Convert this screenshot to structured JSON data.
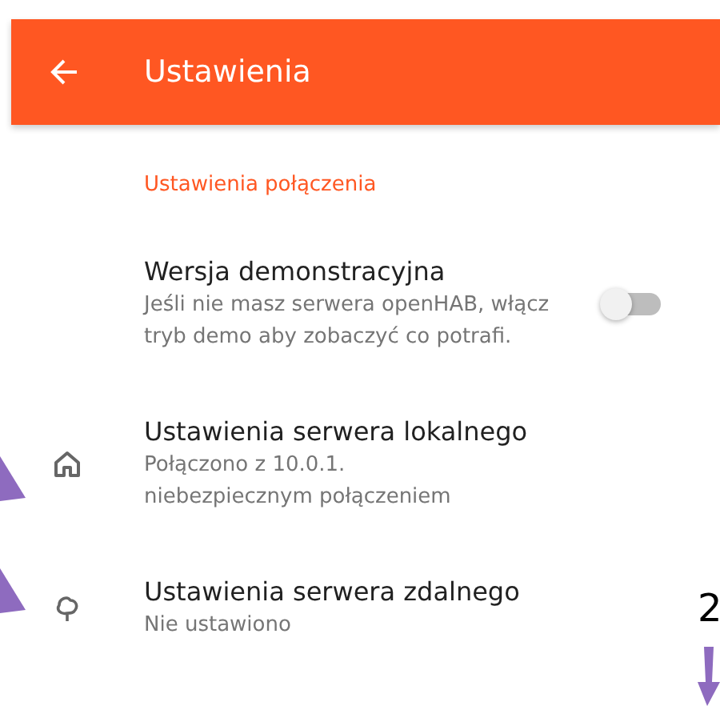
{
  "app_bar": {
    "title": "Ustawienia"
  },
  "category": "Ustawienia połączenia",
  "items": [
    {
      "kind": "switch",
      "title": "Wersja demonstracyjna",
      "summary": "Jeśli nie masz serwera openHAB, włącz tryb demo aby zobaczyć co potrafi.",
      "on": false
    },
    {
      "kind": "plain",
      "title": "Ustawienia serwera lokalnego",
      "summary": "Połączono z 10.0.1.        niebezpiecznym połączeniem"
    },
    {
      "kind": "plain",
      "title": "Ustawienia serwera zdalnego",
      "summary": "Nie ustawiono"
    }
  ],
  "annotation_label": "2"
}
